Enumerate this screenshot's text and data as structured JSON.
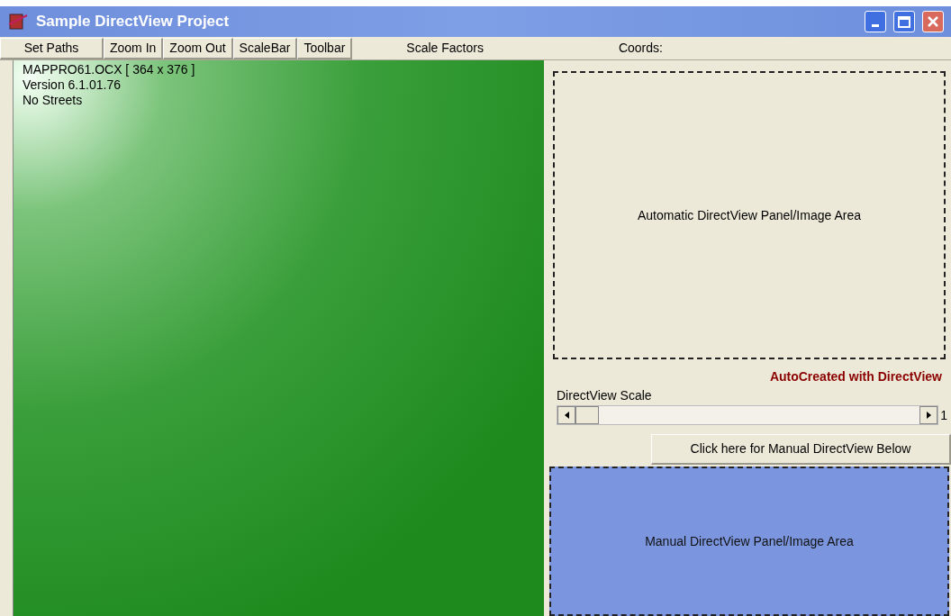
{
  "window": {
    "title": "Sample DirectView Project"
  },
  "toolbar": {
    "buttons": [
      "Set Paths",
      "Zoom In",
      "Zoom Out",
      "ScaleBar",
      "Toolbar"
    ],
    "labels": [
      "Scale Factors",
      "Coords:"
    ]
  },
  "map": {
    "info_lines": [
      "MAPPRO61.OCX [ 364 x 376 ]",
      "Version 6.1.01.76",
      "No Streets"
    ]
  },
  "auto_panel": {
    "label": "Automatic DirectView Panel/Image Area"
  },
  "autocreated_note": "AutoCreated with DirectView",
  "scale": {
    "label": "DirectView Scale",
    "level": 0,
    "reading": "1"
  },
  "manual_button": "Click here for Manual DirectView Below",
  "manual_panel": {
    "label": "Manual DirectView Panel/Image Area"
  }
}
